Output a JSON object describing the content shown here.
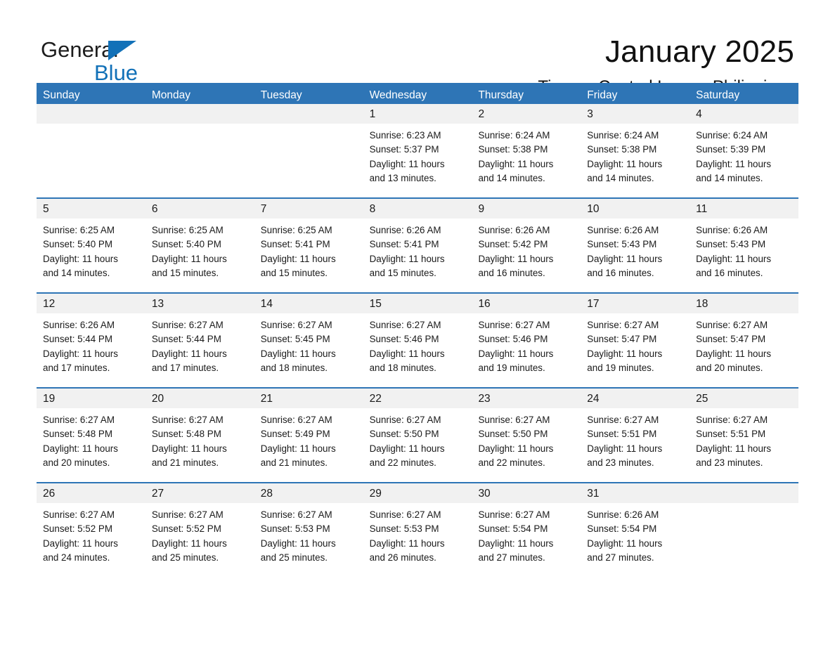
{
  "brand": {
    "name_part1": "General",
    "name_part2": "Blue",
    "accent_color": "#1271b8",
    "logo_icon": "triangle-flag-icon"
  },
  "header": {
    "month_title": "January 2025",
    "location": "Tinang, Central Luzon, Philippines"
  },
  "theme": {
    "header_blue": "#2e75b6",
    "day_band_gray": "#f1f1f1",
    "text_color": "#1a1a1a"
  },
  "weekdays": [
    "Sunday",
    "Monday",
    "Tuesday",
    "Wednesday",
    "Thursday",
    "Friday",
    "Saturday"
  ],
  "weeks": [
    [
      {
        "day": "",
        "sunrise": "",
        "sunset": "",
        "daylight_line1": "",
        "daylight_line2": ""
      },
      {
        "day": "",
        "sunrise": "",
        "sunset": "",
        "daylight_line1": "",
        "daylight_line2": ""
      },
      {
        "day": "",
        "sunrise": "",
        "sunset": "",
        "daylight_line1": "",
        "daylight_line2": ""
      },
      {
        "day": "1",
        "sunrise": "Sunrise: 6:23 AM",
        "sunset": "Sunset: 5:37 PM",
        "daylight_line1": "Daylight: 11 hours",
        "daylight_line2": "and 13 minutes."
      },
      {
        "day": "2",
        "sunrise": "Sunrise: 6:24 AM",
        "sunset": "Sunset: 5:38 PM",
        "daylight_line1": "Daylight: 11 hours",
        "daylight_line2": "and 14 minutes."
      },
      {
        "day": "3",
        "sunrise": "Sunrise: 6:24 AM",
        "sunset": "Sunset: 5:38 PM",
        "daylight_line1": "Daylight: 11 hours",
        "daylight_line2": "and 14 minutes."
      },
      {
        "day": "4",
        "sunrise": "Sunrise: 6:24 AM",
        "sunset": "Sunset: 5:39 PM",
        "daylight_line1": "Daylight: 11 hours",
        "daylight_line2": "and 14 minutes."
      }
    ],
    [
      {
        "day": "5",
        "sunrise": "Sunrise: 6:25 AM",
        "sunset": "Sunset: 5:40 PM",
        "daylight_line1": "Daylight: 11 hours",
        "daylight_line2": "and 14 minutes."
      },
      {
        "day": "6",
        "sunrise": "Sunrise: 6:25 AM",
        "sunset": "Sunset: 5:40 PM",
        "daylight_line1": "Daylight: 11 hours",
        "daylight_line2": "and 15 minutes."
      },
      {
        "day": "7",
        "sunrise": "Sunrise: 6:25 AM",
        "sunset": "Sunset: 5:41 PM",
        "daylight_line1": "Daylight: 11 hours",
        "daylight_line2": "and 15 minutes."
      },
      {
        "day": "8",
        "sunrise": "Sunrise: 6:26 AM",
        "sunset": "Sunset: 5:41 PM",
        "daylight_line1": "Daylight: 11 hours",
        "daylight_line2": "and 15 minutes."
      },
      {
        "day": "9",
        "sunrise": "Sunrise: 6:26 AM",
        "sunset": "Sunset: 5:42 PM",
        "daylight_line1": "Daylight: 11 hours",
        "daylight_line2": "and 16 minutes."
      },
      {
        "day": "10",
        "sunrise": "Sunrise: 6:26 AM",
        "sunset": "Sunset: 5:43 PM",
        "daylight_line1": "Daylight: 11 hours",
        "daylight_line2": "and 16 minutes."
      },
      {
        "day": "11",
        "sunrise": "Sunrise: 6:26 AM",
        "sunset": "Sunset: 5:43 PM",
        "daylight_line1": "Daylight: 11 hours",
        "daylight_line2": "and 16 minutes."
      }
    ],
    [
      {
        "day": "12",
        "sunrise": "Sunrise: 6:26 AM",
        "sunset": "Sunset: 5:44 PM",
        "daylight_line1": "Daylight: 11 hours",
        "daylight_line2": "and 17 minutes."
      },
      {
        "day": "13",
        "sunrise": "Sunrise: 6:27 AM",
        "sunset": "Sunset: 5:44 PM",
        "daylight_line1": "Daylight: 11 hours",
        "daylight_line2": "and 17 minutes."
      },
      {
        "day": "14",
        "sunrise": "Sunrise: 6:27 AM",
        "sunset": "Sunset: 5:45 PM",
        "daylight_line1": "Daylight: 11 hours",
        "daylight_line2": "and 18 minutes."
      },
      {
        "day": "15",
        "sunrise": "Sunrise: 6:27 AM",
        "sunset": "Sunset: 5:46 PM",
        "daylight_line1": "Daylight: 11 hours",
        "daylight_line2": "and 18 minutes."
      },
      {
        "day": "16",
        "sunrise": "Sunrise: 6:27 AM",
        "sunset": "Sunset: 5:46 PM",
        "daylight_line1": "Daylight: 11 hours",
        "daylight_line2": "and 19 minutes."
      },
      {
        "day": "17",
        "sunrise": "Sunrise: 6:27 AM",
        "sunset": "Sunset: 5:47 PM",
        "daylight_line1": "Daylight: 11 hours",
        "daylight_line2": "and 19 minutes."
      },
      {
        "day": "18",
        "sunrise": "Sunrise: 6:27 AM",
        "sunset": "Sunset: 5:47 PM",
        "daylight_line1": "Daylight: 11 hours",
        "daylight_line2": "and 20 minutes."
      }
    ],
    [
      {
        "day": "19",
        "sunrise": "Sunrise: 6:27 AM",
        "sunset": "Sunset: 5:48 PM",
        "daylight_line1": "Daylight: 11 hours",
        "daylight_line2": "and 20 minutes."
      },
      {
        "day": "20",
        "sunrise": "Sunrise: 6:27 AM",
        "sunset": "Sunset: 5:48 PM",
        "daylight_line1": "Daylight: 11 hours",
        "daylight_line2": "and 21 minutes."
      },
      {
        "day": "21",
        "sunrise": "Sunrise: 6:27 AM",
        "sunset": "Sunset: 5:49 PM",
        "daylight_line1": "Daylight: 11 hours",
        "daylight_line2": "and 21 minutes."
      },
      {
        "day": "22",
        "sunrise": "Sunrise: 6:27 AM",
        "sunset": "Sunset: 5:50 PM",
        "daylight_line1": "Daylight: 11 hours",
        "daylight_line2": "and 22 minutes."
      },
      {
        "day": "23",
        "sunrise": "Sunrise: 6:27 AM",
        "sunset": "Sunset: 5:50 PM",
        "daylight_line1": "Daylight: 11 hours",
        "daylight_line2": "and 22 minutes."
      },
      {
        "day": "24",
        "sunrise": "Sunrise: 6:27 AM",
        "sunset": "Sunset: 5:51 PM",
        "daylight_line1": "Daylight: 11 hours",
        "daylight_line2": "and 23 minutes."
      },
      {
        "day": "25",
        "sunrise": "Sunrise: 6:27 AM",
        "sunset": "Sunset: 5:51 PM",
        "daylight_line1": "Daylight: 11 hours",
        "daylight_line2": "and 23 minutes."
      }
    ],
    [
      {
        "day": "26",
        "sunrise": "Sunrise: 6:27 AM",
        "sunset": "Sunset: 5:52 PM",
        "daylight_line1": "Daylight: 11 hours",
        "daylight_line2": "and 24 minutes."
      },
      {
        "day": "27",
        "sunrise": "Sunrise: 6:27 AM",
        "sunset": "Sunset: 5:52 PM",
        "daylight_line1": "Daylight: 11 hours",
        "daylight_line2": "and 25 minutes."
      },
      {
        "day": "28",
        "sunrise": "Sunrise: 6:27 AM",
        "sunset": "Sunset: 5:53 PM",
        "daylight_line1": "Daylight: 11 hours",
        "daylight_line2": "and 25 minutes."
      },
      {
        "day": "29",
        "sunrise": "Sunrise: 6:27 AM",
        "sunset": "Sunset: 5:53 PM",
        "daylight_line1": "Daylight: 11 hours",
        "daylight_line2": "and 26 minutes."
      },
      {
        "day": "30",
        "sunrise": "Sunrise: 6:27 AM",
        "sunset": "Sunset: 5:54 PM",
        "daylight_line1": "Daylight: 11 hours",
        "daylight_line2": "and 27 minutes."
      },
      {
        "day": "31",
        "sunrise": "Sunrise: 6:26 AM",
        "sunset": "Sunset: 5:54 PM",
        "daylight_line1": "Daylight: 11 hours",
        "daylight_line2": "and 27 minutes."
      },
      {
        "day": "",
        "sunrise": "",
        "sunset": "",
        "daylight_line1": "",
        "daylight_line2": ""
      }
    ]
  ]
}
